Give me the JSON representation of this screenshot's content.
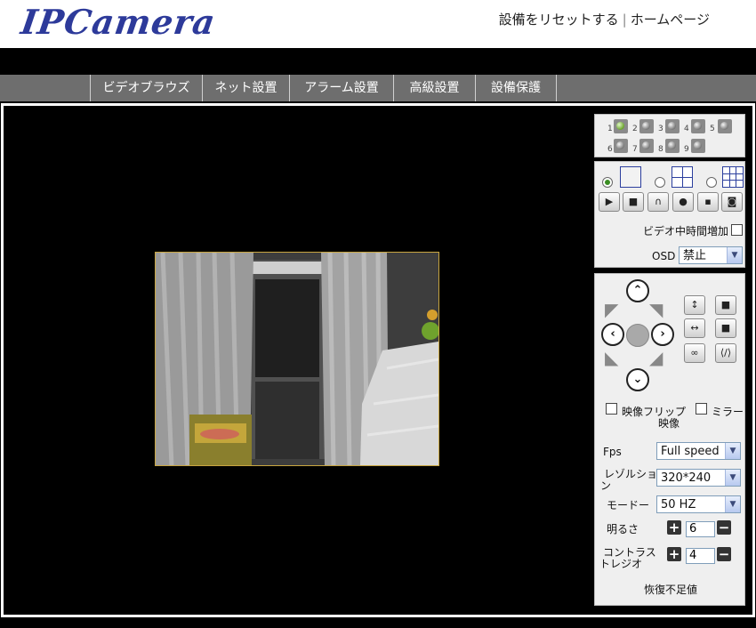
{
  "header": {
    "logo": "IPCamera",
    "reset_link": "設備をリセットする",
    "separator": "|",
    "home_link": "ホームページ"
  },
  "nav": [
    "ビデオブラウズ",
    "ネット設置",
    "アラーム設置",
    "高級設置",
    "設備保護"
  ],
  "channels": [
    "1",
    "2",
    "3",
    "4",
    "5",
    "6",
    "7",
    "8",
    "9"
  ],
  "active_channel": "1",
  "controls": {
    "video_time_label": "ビデオ中時間増加",
    "osd_label": "OSD",
    "osd_value": "禁止"
  },
  "ptz": {
    "flip_label": "映像フリップ",
    "mirror_label": "ミラー",
    "flip_label_wrap": "映像"
  },
  "settings": {
    "fps_label": "Fps",
    "fps_value": "Full speed",
    "resolution_label_a": "レゾルショ",
    "resolution_label_b": "ン",
    "resolution_value": "320*240",
    "mode_label": "モードー",
    "mode_value": "50 HZ",
    "brightness_label": "明るさ",
    "brightness_value": "6",
    "contrast_label_a": "コントラス",
    "contrast_label_b": "トレジオ",
    "contrast_value": "4",
    "restore_label": "恢復不足値"
  }
}
